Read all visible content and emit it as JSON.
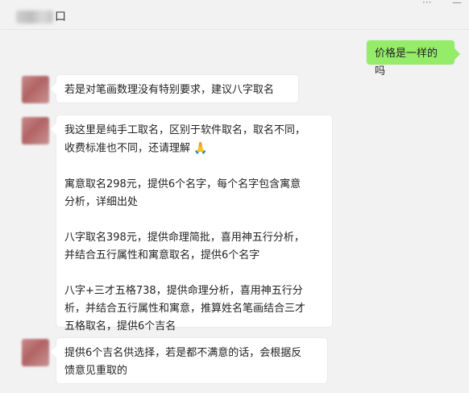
{
  "chat": {
    "contact_suffix": "口",
    "messages": [
      {
        "from": "me",
        "text": "价格是一样的吗"
      },
      {
        "from": "them",
        "text": "若是对笔画数理没有特别要求，建议八字取名"
      },
      {
        "from": "them",
        "paragraphs": [
          {
            "lines": [
              "我这里是纯手工取名，区别于软件取名，取名不同，",
              "收费标准也不同，还请理解"
            ],
            "icon": "folded-hands-emoji"
          },
          {
            "lines": [
              "寓意取名298元，提供6个名字，每个名字包含寓意",
              "分析，详细出处"
            ]
          },
          {
            "lines": [
              "八字取名398元，提供命理简批，喜用神五行分析，",
              "并结合五行属性和寓意取名，提供6个名字"
            ]
          },
          {
            "lines": [
              "八字+三才五格738，提供命理分析，喜用神五行分",
              "析，并结合五行属性和寓意，推算姓名笔画结合三才",
              "五格取名，提供6个吉名"
            ]
          }
        ]
      },
      {
        "from": "them",
        "lines": [
          "提供6个吉名供选择，若是都不满意的话，会根据反",
          "馈意见重取的"
        ]
      }
    ]
  },
  "window": {
    "more_icon": "ellipsis-icon",
    "close_icon": "close-icon",
    "more_glyph": "···",
    "close_glyph": "—"
  }
}
